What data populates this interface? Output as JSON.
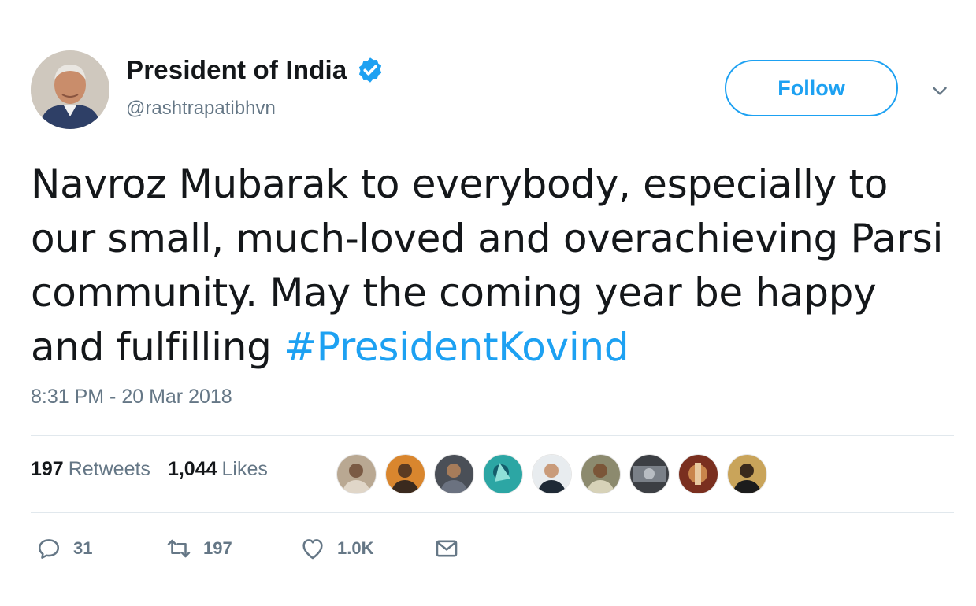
{
  "user": {
    "display_name": "President of India",
    "handle": "@rashtrapatibhvn",
    "verified": true
  },
  "follow_label": "Follow",
  "tweet": {
    "text": "Navroz Mubarak to everybody, especially to our small, much-loved and overachieving Parsi community. May the coming year be happy and fulfilling",
    "hashtag": "#PresidentKovind",
    "timestamp": "8:31 PM - 20 Mar 2018"
  },
  "stats": {
    "retweets_count": "197",
    "retweets_label": "Retweets",
    "likes_count": "1,044",
    "likes_label": "Likes"
  },
  "actions": {
    "replies": "31",
    "retweets": "197",
    "likes": "1.0K"
  },
  "icons": [
    "verified-badge-icon",
    "chevron-down-icon",
    "reply-icon",
    "retweet-icon",
    "heart-icon",
    "mail-icon"
  ],
  "colors": {
    "accent": "#1da1f2",
    "text": "#14171a",
    "muted": "#657786",
    "divider": "#e1e8ed"
  }
}
